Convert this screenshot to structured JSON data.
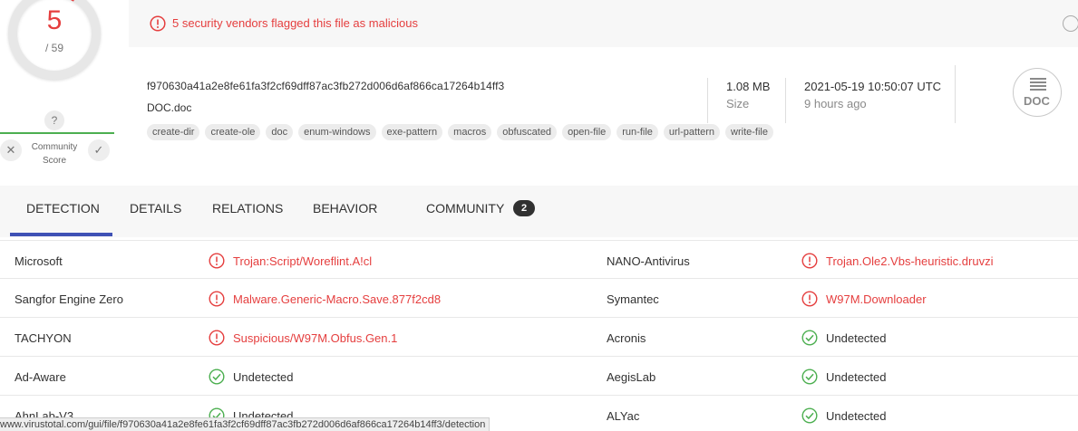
{
  "score": {
    "positives": "5",
    "total": "/ 59",
    "community_question": "?",
    "community_label_line1": "Community",
    "community_label_line2": "Score",
    "vote_down_glyph": "✕",
    "vote_up_glyph": "✓",
    "malicious_fraction": 0.085
  },
  "banner": {
    "message": "5 security vendors flagged this file as malicious"
  },
  "file": {
    "hash": "f970630a41a2e8fe61fa3f2cf69dff87ac3fb272d006d6af866ca17264b14ff3",
    "name": "DOC.doc",
    "tags": [
      "create-dir",
      "create-ole",
      "doc",
      "enum-windows",
      "exe-pattern",
      "macros",
      "obfuscated",
      "open-file",
      "run-file",
      "url-pattern",
      "write-file"
    ],
    "size_value": "1.08 MB",
    "size_label": "Size",
    "date_value": "2021-05-19 10:50:07 UTC",
    "date_label": "9 hours ago",
    "type_icon_text": "DOC"
  },
  "tabs": {
    "detection": "DETECTION",
    "details": "DETAILS",
    "relations": "RELATIONS",
    "behavior": "BEHAVIOR",
    "community": "COMMUNITY",
    "community_count": "2"
  },
  "detections": [
    {
      "left": {
        "engine": "Microsoft",
        "result": "Trojan:Script/Woreflint.A!cl",
        "status": "malicious"
      },
      "right": {
        "engine": "NANO-Antivirus",
        "result": "Trojan.Ole2.Vbs-heuristic.druvzi",
        "status": "malicious"
      }
    },
    {
      "left": {
        "engine": "Sangfor Engine Zero",
        "result": "Malware.Generic-Macro.Save.877f2cd8",
        "status": "malicious"
      },
      "right": {
        "engine": "Symantec",
        "result": "W97M.Downloader",
        "status": "malicious"
      }
    },
    {
      "left": {
        "engine": "TACHYON",
        "result": "Suspicious/W97M.Obfus.Gen.1",
        "status": "malicious"
      },
      "right": {
        "engine": "Acronis",
        "result": "Undetected",
        "status": "clean"
      }
    },
    {
      "left": {
        "engine": "Ad-Aware",
        "result": "Undetected",
        "status": "clean"
      },
      "right": {
        "engine": "AegisLab",
        "result": "Undetected",
        "status": "clean"
      }
    },
    {
      "left": {
        "engine": "AhnLab-V3",
        "result": "Undetected",
        "status": "clean"
      },
      "right": {
        "engine": "ALYac",
        "result": "Undetected",
        "status": "clean"
      }
    }
  ],
  "statusbar": {
    "url": "www.virustotal.com/gui/file/f970630a41a2e8fe61fa3f2cf69dff87ac3fb272d006d6af866ca17264b14ff3/detection"
  },
  "colors": {
    "malicious": "#e53e3e",
    "clean": "#4caf50",
    "accent": "#3f51b5"
  }
}
